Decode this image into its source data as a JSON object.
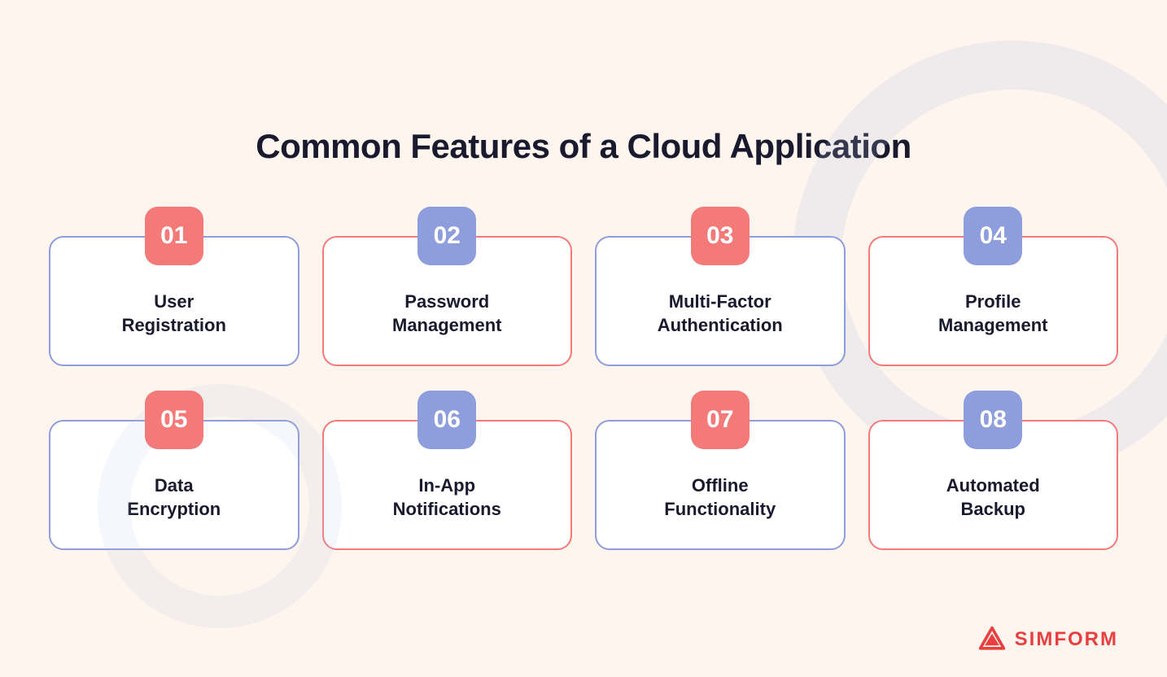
{
  "page": {
    "title": "Common Features of a Cloud Application"
  },
  "logo": {
    "text": "SIMFORM"
  },
  "cards": [
    {
      "number": "01",
      "label": "User\nRegistration",
      "badgeType": "pink",
      "borderType": "blue"
    },
    {
      "number": "02",
      "label": "Password\nManagement",
      "badgeType": "blue",
      "borderType": "pink"
    },
    {
      "number": "03",
      "label": "Multi-Factor\nAuthentication",
      "badgeType": "pink",
      "borderType": "blue"
    },
    {
      "number": "04",
      "label": "Profile\nManagement",
      "badgeType": "blue",
      "borderType": "pink"
    },
    {
      "number": "05",
      "label": "Data\nEncryption",
      "badgeType": "pink",
      "borderType": "blue"
    },
    {
      "number": "06",
      "label": "In-App\nNotifications",
      "badgeType": "blue",
      "borderType": "pink"
    },
    {
      "number": "07",
      "label": "Offline\nFunctionality",
      "badgeType": "pink",
      "borderType": "blue"
    },
    {
      "number": "08",
      "label": "Automated\nBackup",
      "badgeType": "blue",
      "borderType": "pink"
    }
  ]
}
